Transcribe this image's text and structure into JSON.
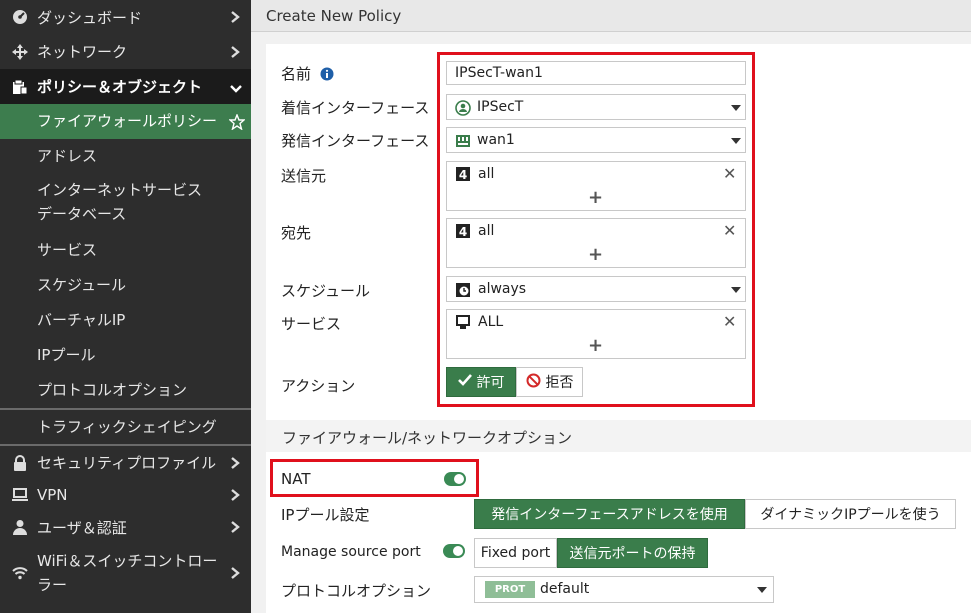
{
  "sidebar": {
    "items": [
      {
        "label": "ダッシュボード",
        "icon": "dashboard-icon"
      },
      {
        "label": "ネットワーク",
        "icon": "network-move-icon"
      },
      {
        "label": "ポリシー＆オブジェクト",
        "icon": "policy-icon"
      },
      {
        "label": "セキュリティプロファイル",
        "icon": "lock-icon"
      },
      {
        "label": "VPN",
        "icon": "laptop-icon"
      },
      {
        "label": "ユーザ＆認証",
        "icon": "user-icon"
      },
      {
        "label": "WiFi＆スイッチコントローラー",
        "icon": "wifi-icon"
      }
    ],
    "sub_items": [
      "ファイアウォールポリシー",
      "アドレス",
      "インターネットサービスデータベース",
      "サービス",
      "スケジュール",
      "バーチャルIP",
      "IPプール",
      "プロトコルオプション",
      "トラフィックシェイピング"
    ],
    "active_accent": "#3d7d4e"
  },
  "header": {
    "title": "Create New Policy"
  },
  "form": {
    "name_label": "名前",
    "name_value": "IPSecT-wan1",
    "incoming_label": "着信インターフェース",
    "incoming_value": "IPSecT",
    "outgoing_label": "発信インターフェース",
    "outgoing_value": "wan1",
    "source_label": "送信元",
    "source_value": "all",
    "dest_label": "宛先",
    "dest_value": "all",
    "schedule_label": "スケジュール",
    "schedule_value": "always",
    "service_label": "サービス",
    "service_value": "ALL",
    "action_label": "アクション",
    "action_accept": "許可",
    "action_deny": "拒否"
  },
  "fw_options": {
    "section_title": "ファイアウォール/ネットワークオプション",
    "nat_label": "NAT",
    "ippool_label": "IPプール設定",
    "ippool_opt1": "発信インターフェースアドレスを使用",
    "ippool_opt2": "ダイナミックIPプールを使う",
    "msp_label": "Manage source port",
    "msp_opt1": "Fixed port",
    "msp_opt2": "送信元ポートの保持",
    "proto_label": "プロトコルオプション",
    "proto_badge": "PROT",
    "proto_value": "default"
  },
  "colors": {
    "highlight": "#e0101c",
    "green": "#3a7d4b"
  }
}
